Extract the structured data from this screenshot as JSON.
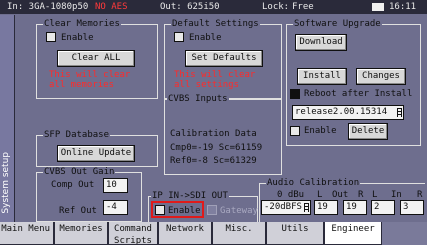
{
  "status": {
    "input": "In: 3GA-1080p50",
    "audio_alert": "NO AES",
    "output": "Out: 625i50",
    "lock": "Lock:",
    "free": "Free",
    "time": "16:11"
  },
  "side_tab": "System setup",
  "clear_memories": {
    "title": "Clear Memories",
    "enable_label": "Enable",
    "button": "Clear ALL",
    "warning_line1": "This will clear",
    "warning_line2": "all memories"
  },
  "default_settings": {
    "title": "Default Settings",
    "enable_label": "Enable",
    "button": "Set Defaults",
    "warning_line1": "This will clear",
    "warning_line2": "all settings"
  },
  "software_upgrade": {
    "title": "Software Upgrade",
    "download_button": "Download",
    "install_button": "Install",
    "changes_button": "Changes",
    "reboot_label": "Reboot after Install",
    "release_value": "release2.00.15314",
    "enable_label": "Enable",
    "delete_button": "Delete"
  },
  "cvbs_inputs": {
    "title": "CVBS Inputs",
    "cal_title": "Calibration Data",
    "cmp_line": "Cmp0=-19 Sc=61159",
    "ref_line": "Ref0=-8  Sc=61329"
  },
  "sfp_database": {
    "title": "SFP Database",
    "button": "Online Update"
  },
  "cvbs_out_gain": {
    "title": "CVBS Out Gain",
    "comp_label": "Comp Out",
    "comp_value": "10",
    "ref_label": "Ref Out",
    "ref_value": "-4"
  },
  "ip_sdi_out": {
    "title": "IP IN->SDI OUT",
    "enable_label": "Enable",
    "gateway_label": "Gateway"
  },
  "audio_calibration": {
    "title": "Audio Calibration",
    "header_dbu": "0 dBu",
    "header_l1": "L",
    "header_out": "Out",
    "header_r1": "R",
    "header_l2": "L",
    "header_in": "In",
    "header_r2": "R",
    "level_value": "-20dBFS",
    "out_l": "19",
    "out_r": "19",
    "in_l": "2",
    "in_r": "3"
  },
  "tabs": [
    {
      "label": "Main Menu"
    },
    {
      "label": "Memories"
    },
    {
      "label": "Command Scripts"
    },
    {
      "label": "Network"
    },
    {
      "label": "Misc."
    },
    {
      "label": "Utils"
    },
    {
      "label": "Engineer"
    }
  ],
  "colors": {
    "background": "#6e6e8e",
    "warning": "#ff2a2a",
    "highlight": "#e01a1a",
    "active_tab": "#ffffff"
  }
}
